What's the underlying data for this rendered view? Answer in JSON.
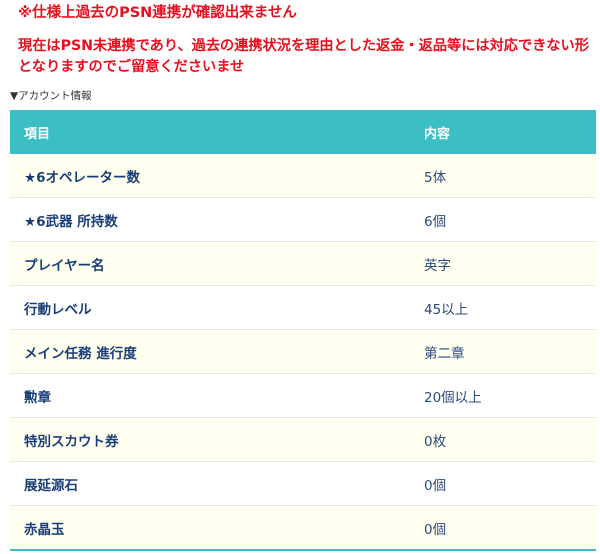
{
  "notice": {
    "line1": "※仕様上過去のPSN連携が確認出来ません",
    "paragraph": "現在はPSN未連携であり、過去の連携状況を理由とした返金・返品等には対応できない形となりますのでご留意くださいませ"
  },
  "section": {
    "label": "▼アカウント情報"
  },
  "table": {
    "header_item": "項目",
    "header_value": "内容",
    "rows": [
      {
        "label": "★6オペレーター数",
        "value": "5体"
      },
      {
        "label": "★6武器 所持数",
        "value": "6個"
      },
      {
        "label": "プレイヤー名",
        "value": "英字"
      },
      {
        "label": "行動レベル",
        "value": "45以上"
      },
      {
        "label": "メイン任務 進行度",
        "value": "第二章"
      },
      {
        "label": "勲章",
        "value": "20個以上"
      },
      {
        "label": "特別スカウト券",
        "value": "0枚"
      },
      {
        "label": "展延源石",
        "value": "0個"
      },
      {
        "label": "赤晶玉",
        "value": "0個"
      }
    ]
  },
  "colors": {
    "notice_red": "#e8101e",
    "header_teal": "#3bbfc4",
    "label_navy": "#1a3e78",
    "row_alt_bg": "#fffff0"
  }
}
